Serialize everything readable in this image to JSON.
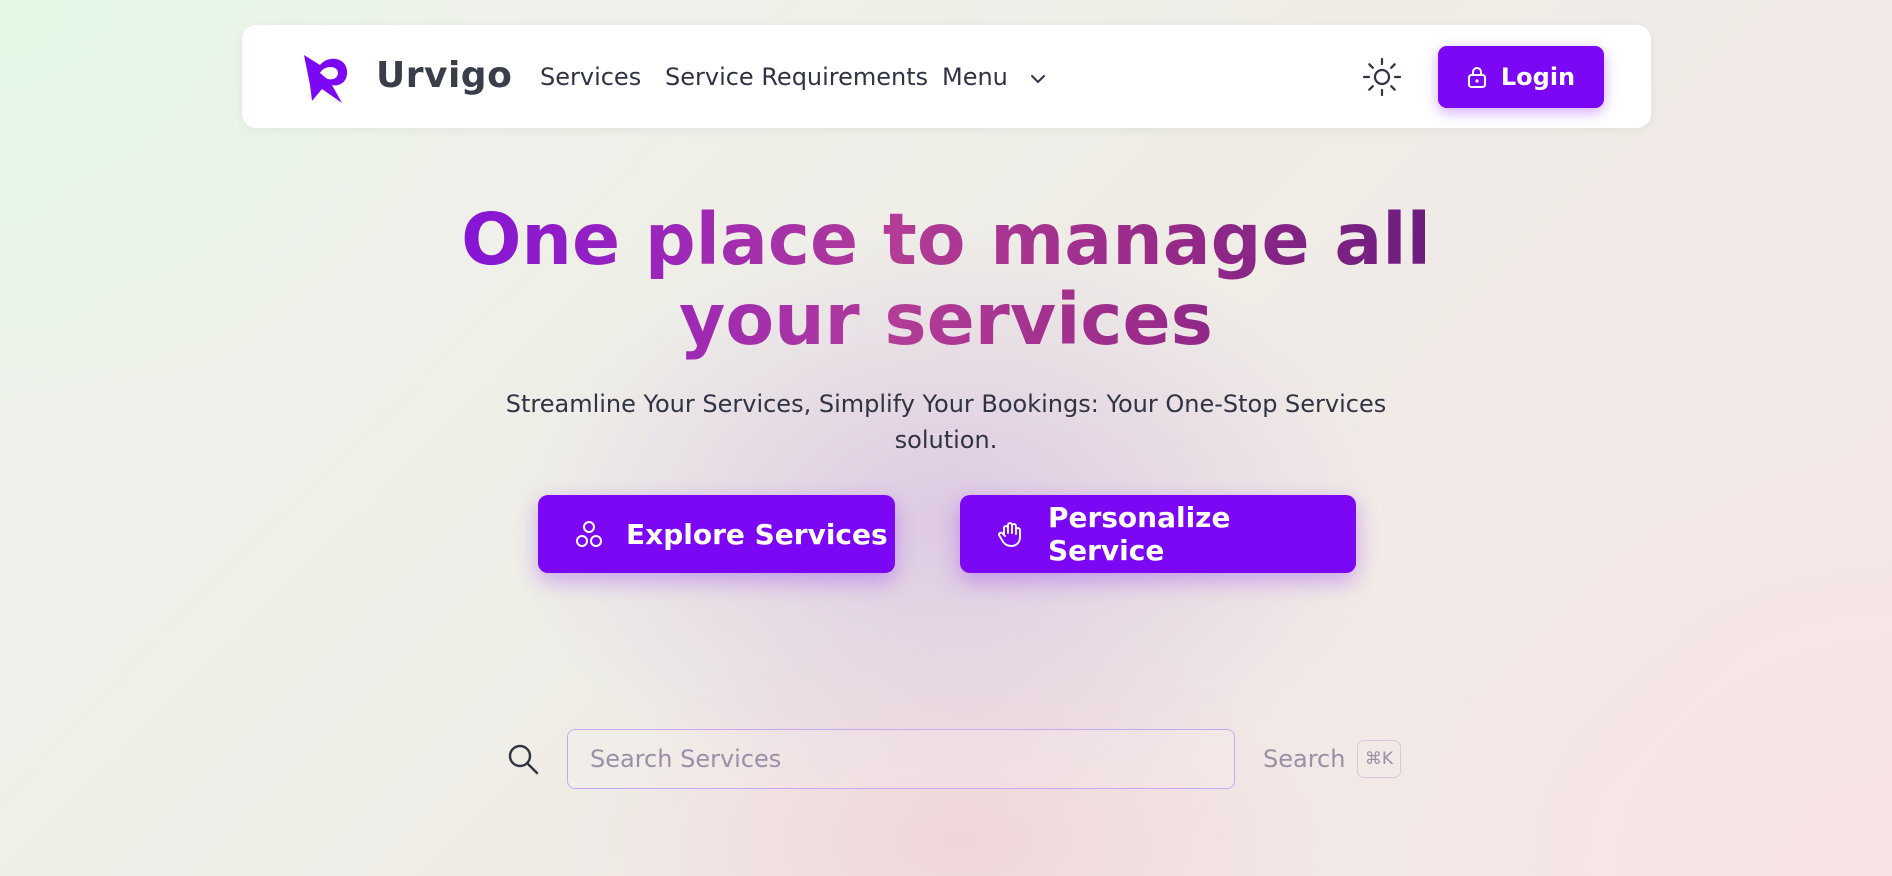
{
  "brand": {
    "name": "Urvigo",
    "accent": "#7b07f5"
  },
  "nav": {
    "links": [
      {
        "label": "Services"
      },
      {
        "label": "Service Requirements"
      },
      {
        "label": "Menu"
      }
    ],
    "theme_icon": "sun-icon",
    "login_label": "Login",
    "login_icon": "lock-icon"
  },
  "hero": {
    "title_line1": "One place to manage all",
    "title_line2": "your services",
    "subtitle_line1": "Streamline Your Services, Simplify Your Bookings: Your One-Stop Services",
    "subtitle_line2": "solution."
  },
  "actions": {
    "explore_label": "Explore Services",
    "explore_icon": "circles-icon",
    "personalize_label": "Personalize Service",
    "personalize_icon": "hand-icon"
  },
  "search": {
    "placeholder": "Search Services",
    "value": "",
    "button_label": "Search",
    "shortcut": "⌘K"
  }
}
